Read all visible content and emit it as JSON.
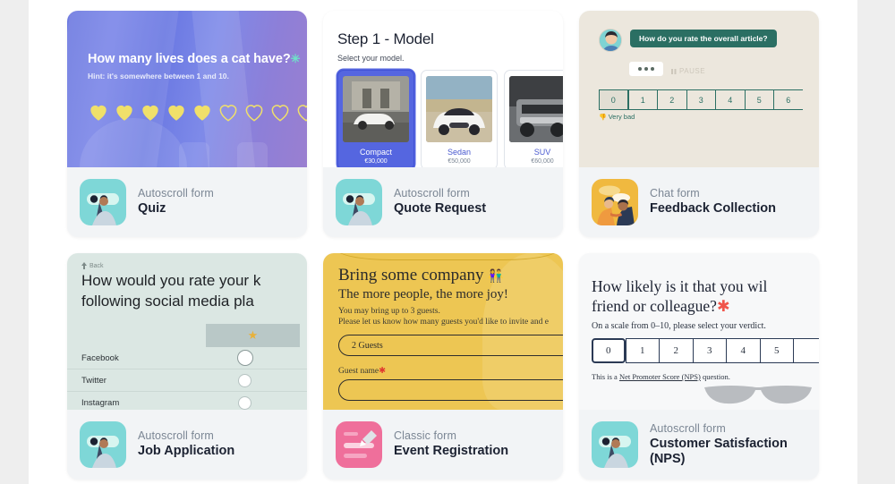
{
  "cards": [
    {
      "id": "quiz",
      "form_type": "Autoscroll form",
      "title": "Quiz",
      "icon": "binoculars-person-icon",
      "icon_bg": "#7ed7d7",
      "preview": {
        "question": "How many lives does a cat have?",
        "required_mark": "✳",
        "hint": "Hint: it's somewhere between 1 and 10.",
        "hearts_filled": 5,
        "hearts_total": 9,
        "heart_color": "#f0e06a",
        "bg_color": "#6d7ae0"
      }
    },
    {
      "id": "quote-request",
      "form_type": "Autoscroll form",
      "title": "Quote Request",
      "icon": "binoculars-person-icon",
      "icon_bg": "#7ed7d7",
      "preview": {
        "step_title": "Step 1 - Model",
        "step_sub": "Select your model.",
        "models": [
          {
            "name": "Compact",
            "price": "€30,000",
            "selected": true
          },
          {
            "name": "Sedan",
            "price": "€50,000",
            "selected": false
          },
          {
            "name": "SUV",
            "price": "€60,000",
            "selected": false
          }
        ],
        "accent": "#5566e0"
      }
    },
    {
      "id": "feedback-collection",
      "form_type": "Chat form",
      "title": "Feedback Collection",
      "icon": "two-people-chat-icon",
      "icon_bg": "#f0b93f",
      "preview": {
        "bubble": "How do you rate the overall article?",
        "pause_label": "PAUSE",
        "scale": [
          "0",
          "1",
          "2",
          "3",
          "4",
          "5",
          "6"
        ],
        "selected": "0",
        "low_label": "Very bad",
        "low_icon": "👎",
        "bg_color": "#ece7dd",
        "accent": "#2b6f63"
      }
    },
    {
      "id": "job-application",
      "form_type": "Autoscroll form",
      "title": "Job Application",
      "icon": "binoculars-person-icon",
      "icon_bg": "#7ed7d7",
      "preview": {
        "back_label": "Back",
        "question": "How would you rate your k",
        "question_line2": "following social media pla",
        "column_header_icon": "★",
        "rows": [
          "Facebook",
          "Twitter",
          "Instagram"
        ],
        "bg_color": "#dbe7e3"
      }
    },
    {
      "id": "event-registration",
      "form_type": "Classic form",
      "title": "Event Registration",
      "icon": "form-pen-icon",
      "icon_bg": "#ef6f9b",
      "preview": {
        "title": "Bring some company",
        "title_emoji": "👫",
        "subtitle": "The more people, the more joy!",
        "line1": "You may bring up to 3 guests.",
        "line2": "Please let us know how many guests you'd like to invite and e",
        "select_value": "2 Guests",
        "field_label": "Guest name",
        "field_required": "✱",
        "field_value": "",
        "bg_color": "#edc653"
      }
    },
    {
      "id": "customer-satisfaction-nps",
      "form_type": "Autoscroll form",
      "title": "Customer Satisfaction (NPS)",
      "icon": "binoculars-person-icon",
      "icon_bg": "#7ed7d7",
      "preview": {
        "question_line1": "How likely is it that you wil",
        "question_line2": "friend or colleague?",
        "required_mark": "✱",
        "subtitle": "On a scale from 0–10, please select your verdict.",
        "scale": [
          "0",
          "1",
          "2",
          "3",
          "4",
          "5"
        ],
        "selected": "0",
        "footnote_pre": "This is a ",
        "footnote_link": "Net Promoter Score (NPS)",
        "footnote_post": " question.",
        "bg_color": "#f7f8f9"
      }
    }
  ]
}
